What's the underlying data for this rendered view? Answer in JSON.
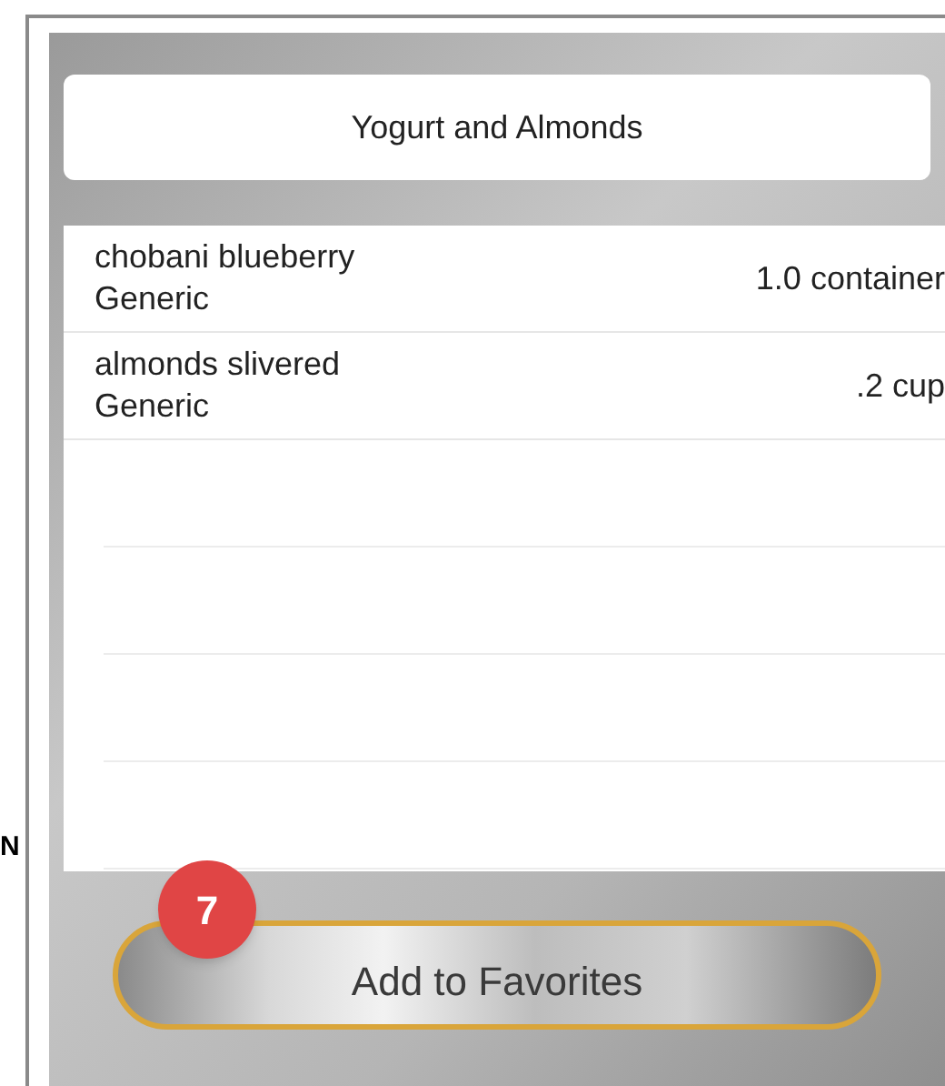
{
  "edge_fragment": "N",
  "title": "Yogurt and Almonds",
  "items": [
    {
      "name": "chobani blueberry",
      "brand": "Generic",
      "amount": "1.0 container"
    },
    {
      "name": "almonds slivered",
      "brand": "Generic",
      "amount": ".2 cup"
    }
  ],
  "badge": "7",
  "button": "Add to Favorites"
}
